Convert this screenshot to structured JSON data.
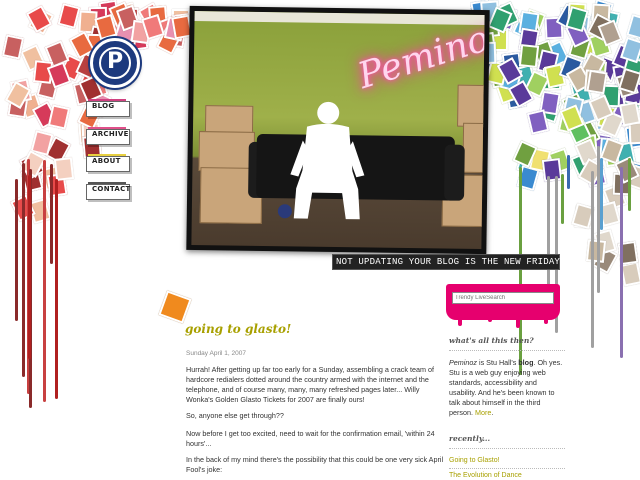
{
  "logo": {
    "letter": "P"
  },
  "nav": {
    "items": [
      {
        "label": "BLOG",
        "tape": "#d04080"
      },
      {
        "label": "ARCHIVE",
        "tape": "#e0508a"
      },
      {
        "label": "ABOUT",
        "tape": "#e8d040"
      },
      {
        "label": "CONTACT",
        "tape": "#555555"
      }
    ]
  },
  "header": {
    "neon_text": "Peminoz",
    "tagline": "NOT UPDATING YOUR BLOG IS THE NEW FRIDAY"
  },
  "post": {
    "title": "going to glasto!",
    "date": "Sunday April 1, 2007",
    "paragraphs": [
      "Hurrah! After getting up far too early for a Sunday, assembling a crack team of hardcore redialers dotted around the country armed with the internet and the telephone, and of course many, many, many refreshed pages later... Willy Wonka's Golden Glasto Tickets for 2007 are finally ours!",
      "So, anyone else get through??",
      "Now before I get too excited, need to wait for the confirmation email, 'within 24 hours'...",
      "In the back of my mind there's the possibility that this could be one very sick April Fool's joke:"
    ]
  },
  "sidebar": {
    "search_placeholder": "Trendy LiveSearch",
    "about_heading": "what's all this then?",
    "about_text_before": "is Stu Hall's ",
    "about_name": "Peminoz",
    "about_bold": "blog",
    "about_text_after": ". Oh yes. Stu is a web guy enjoying web standards, accessibility and usability. And he's been known to talk about himself in the third person. ",
    "about_more": "More",
    "recent_heading": "recently...",
    "recent": [
      "Going to Glasto!",
      "The Evolution of Dance"
    ]
  },
  "colors": {
    "accent_pink": "#e6006e",
    "link_olive": "#a8a000",
    "post_corner_orange": "#f08a1e"
  }
}
